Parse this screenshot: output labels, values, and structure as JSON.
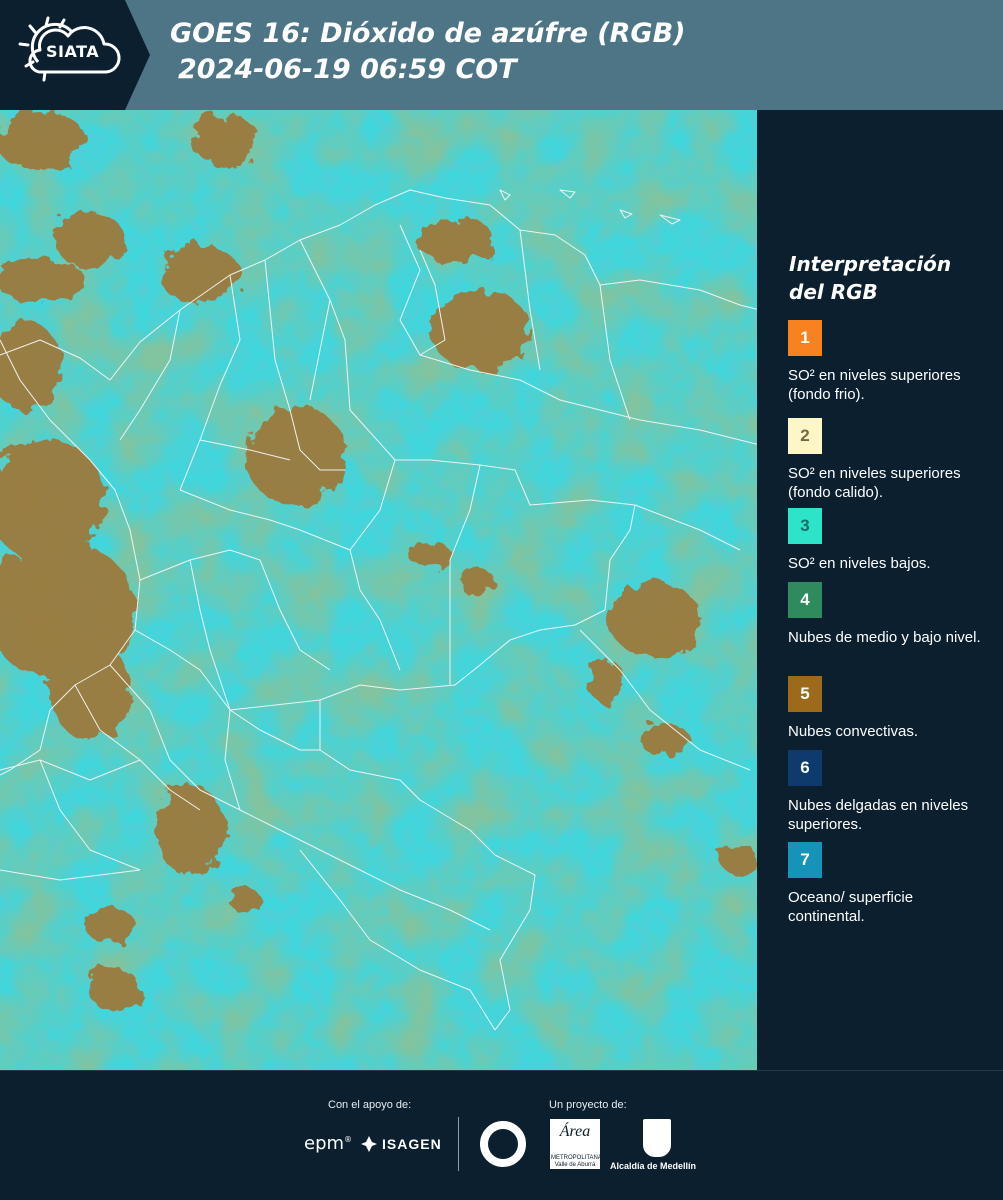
{
  "header": {
    "logo_text": "SIATA",
    "title_line1": "GOES 16: Dióxido de azúfre (RGB)",
    "title_line2": "2024-06-19 06:59 COT",
    "bar_color": "#4d7585",
    "logo_panel_color": "#0b1f2e"
  },
  "map": {
    "image_layer": "goes16-so2-rgb-composite",
    "base_colors": {
      "surface": "#39d6da",
      "low_level": "#1aa0a8",
      "mid_low_clouds": "#3a8a5a",
      "convective": "#9c7a3c"
    },
    "boundary_color": "#f4f7f8"
  },
  "legend": {
    "title_line1": "Interpretación",
    "title_line2": "del RGB",
    "items": [
      {
        "number": "1",
        "color": "#f7821f",
        "text_color": "#ffffff",
        "label": "SO² en niveles superiores (fondo frio)."
      },
      {
        "number": "2",
        "color": "#fdf6c6",
        "text_color": "#6f6a4a",
        "label": "SO² en niveles superiores (fondo calido)."
      },
      {
        "number": "3",
        "color": "#2de3c8",
        "text_color": "#1b6f6a",
        "label": "SO² en niveles bajos."
      },
      {
        "number": "4",
        "color": "#2f8a5e",
        "text_color": "#ffffff",
        "label": "Nubes de medio y bajo nivel."
      },
      {
        "number": "5",
        "color": "#9c6a1a",
        "text_color": "#ffffff",
        "label": "Nubes convectivas."
      },
      {
        "number": "6",
        "color": "#0e3a6e",
        "text_color": "#ffffff",
        "label": "Nubes delgadas en niveles superiores."
      },
      {
        "number": "7",
        "color": "#1593b8",
        "text_color": "#ffffff",
        "label": "Oceano/ superficie continental."
      }
    ]
  },
  "footer": {
    "support_label": "Con el apoyo de:",
    "project_label": "Un proyecto de:",
    "epm_text": "epm",
    "isagen_text": "ISAGEN",
    "amva_line1": "Área",
    "amva_line2": "METROPOLITANA",
    "amva_line3": "Valle de Aburrá",
    "alcaldia_text": "Alcaldía de Medellín"
  }
}
